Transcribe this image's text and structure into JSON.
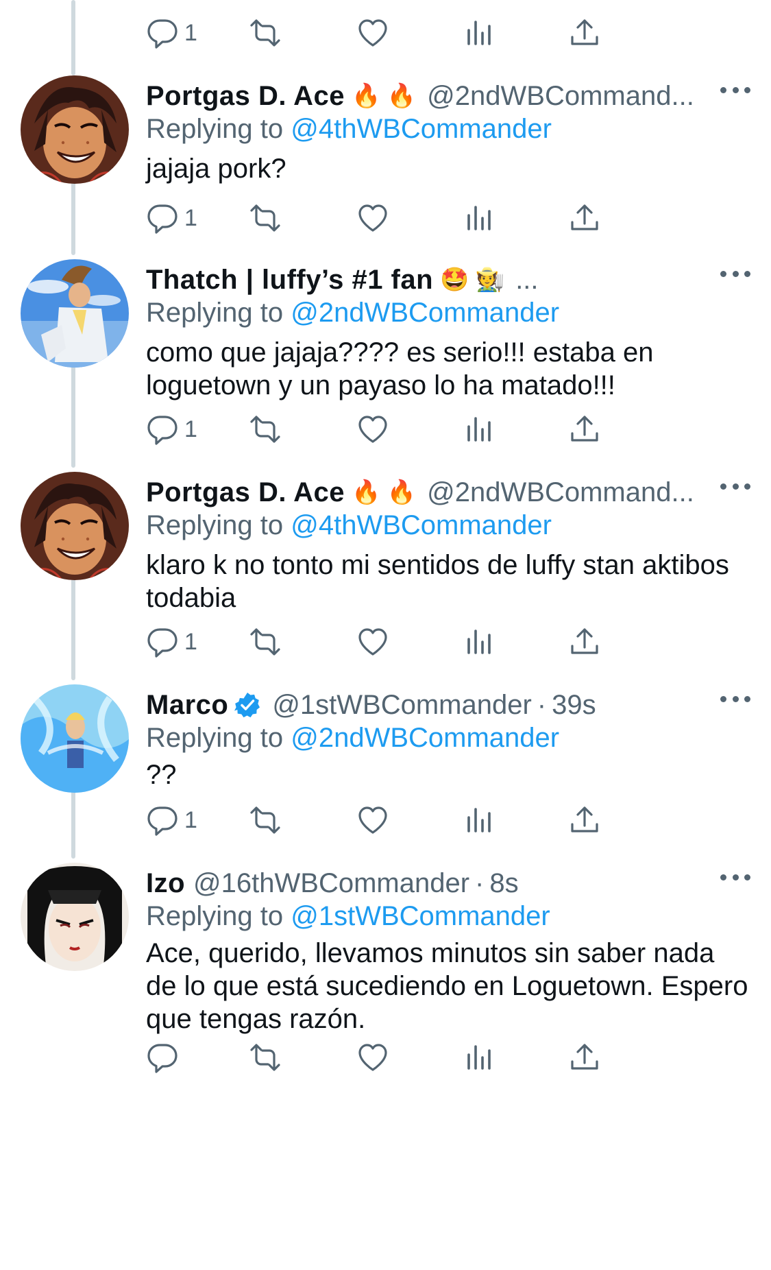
{
  "top_actions": {
    "reply_count": "1"
  },
  "tweets": [
    {
      "name": "Portgas D. Ace",
      "emoji": "🔥 🔥",
      "handle": "@2ndWBCommand...",
      "replying_label": "Replying to",
      "replying_to": "@4thWBCommander",
      "text": "jajaja pork?",
      "reply_count": "1"
    },
    {
      "name": "Thatch | luffy’s #1 fan",
      "emoji": "🤩 🧑‍🌾",
      "handle": "...",
      "replying_label": "Replying to",
      "replying_to": "@2ndWBCommander",
      "text": "como que jajaja???? es serio!!! estaba en loguetown y un payaso lo ha matado!!!",
      "reply_count": "1"
    },
    {
      "name": "Portgas D. Ace",
      "emoji": "🔥 🔥",
      "handle": "@2ndWBCommand...",
      "replying_label": "Replying to",
      "replying_to": "@4thWBCommander",
      "text": "klaro k no tonto mi sentidos de luffy stan aktibos todabia",
      "reply_count": "1"
    },
    {
      "name": "Marco",
      "handle": "@1stWBCommander",
      "dot": "·",
      "time": "39s",
      "replying_label": "Replying to",
      "replying_to": "@2ndWBCommander",
      "text": "??",
      "reply_count": "1"
    },
    {
      "name": "Izo",
      "handle": "@16thWBCommander",
      "dot": "·",
      "time": "8s",
      "replying_label": "Replying to",
      "replying_to": "@1stWBCommander",
      "text": "Ace, querido, llevamos minutos sin saber nada de lo que está sucediendo en Loguetown. Espero que tengas razón.",
      "reply_count": ""
    }
  ],
  "icons": {
    "reply": "reply-icon",
    "retweet": "retweet-icon",
    "like": "heart-icon",
    "views": "views-icon",
    "share": "share-icon",
    "more": "more-icon",
    "verified": "verified-badge-icon"
  },
  "colors": {
    "text": "#0f1419",
    "secondary": "#536471",
    "link": "#1d9bf0",
    "thread_line": "#cfd9de"
  }
}
